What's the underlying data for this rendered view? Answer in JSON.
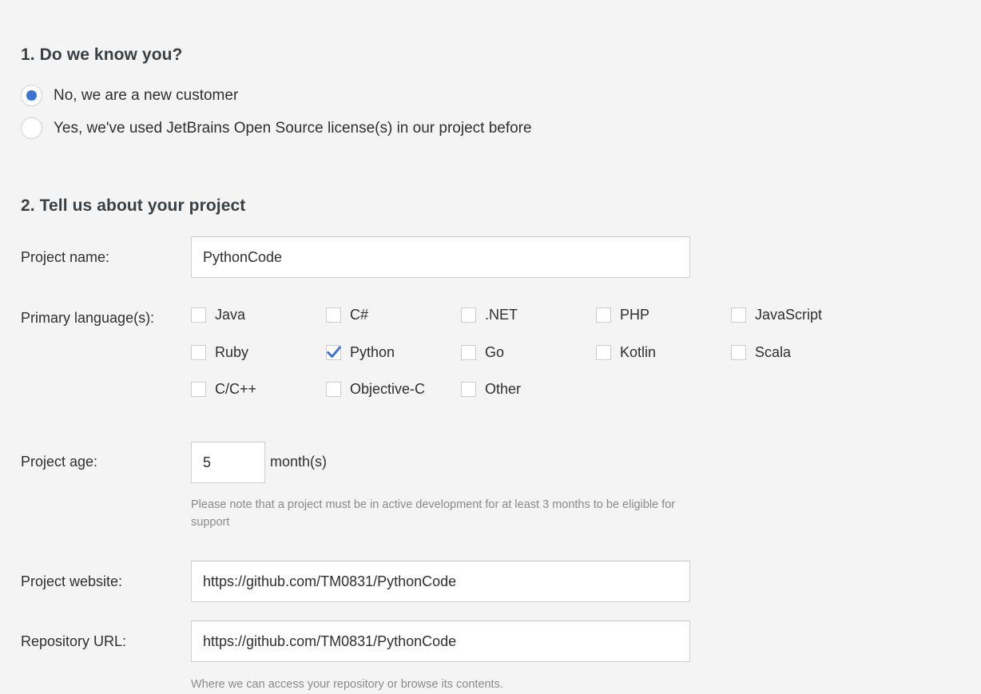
{
  "sections": {
    "know_you": {
      "heading": "1.  Do we know you?",
      "options": [
        {
          "label": "No, we are a new customer",
          "selected": true
        },
        {
          "label": "Yes, we've used JetBrains Open Source license(s) in our project before",
          "selected": false
        }
      ]
    },
    "project": {
      "heading": "2. Tell us about your project",
      "project_name": {
        "label": "Project name:",
        "value": "PythonCode",
        "placeholder": ""
      },
      "primary_languages": {
        "label": "Primary language(s):",
        "options": [
          {
            "label": "Java",
            "checked": false,
            "col": 0,
            "row": 0
          },
          {
            "label": "C#",
            "checked": false,
            "col": 1,
            "row": 0
          },
          {
            "label": ".NET",
            "checked": false,
            "col": 2,
            "row": 0
          },
          {
            "label": "PHP",
            "checked": false,
            "col": 3,
            "row": 0
          },
          {
            "label": "JavaScript",
            "checked": false,
            "col": 4,
            "row": 0
          },
          {
            "label": "Ruby",
            "checked": false,
            "col": 0,
            "row": 1
          },
          {
            "label": "Python",
            "checked": true,
            "col": 1,
            "row": 1
          },
          {
            "label": "Go",
            "checked": false,
            "col": 2,
            "row": 1
          },
          {
            "label": "Kotlin",
            "checked": false,
            "col": 3,
            "row": 1
          },
          {
            "label": "Scala",
            "checked": false,
            "col": 4,
            "row": 1
          },
          {
            "label": "C/C++",
            "checked": false,
            "col": 0,
            "row": 2
          },
          {
            "label": "Objective-C",
            "checked": false,
            "col": 1,
            "row": 2
          },
          {
            "label": "Other",
            "checked": false,
            "col": 2,
            "row": 2
          }
        ]
      },
      "project_age": {
        "label": "Project age:",
        "value": "5",
        "placeholder": "",
        "suffix": "month(s)",
        "hint": "Please note that a project must be in active development for at least 3 months to be eligible for support"
      },
      "project_website": {
        "label": "Project website:",
        "value": "https://github.com/TM0831/PythonCode",
        "placeholder": ""
      },
      "repository_url": {
        "label": "Repository URL:",
        "value": "https://github.com/TM0831/PythonCode",
        "placeholder": "",
        "hint": "Where we can access your repository or browse its contents."
      }
    }
  },
  "colors": {
    "background": "#f4f4f4",
    "accent": "#3b74d4",
    "text": "#2f2f2f",
    "heading": "#3a3f44",
    "hint": "#8a8a8a",
    "input_border": "#cfcfcf"
  },
  "layout": {
    "checkbox_col_x": [
      0,
      169,
      338,
      507,
      676
    ],
    "checkbox_row_y": [
      0,
      47,
      93
    ]
  }
}
